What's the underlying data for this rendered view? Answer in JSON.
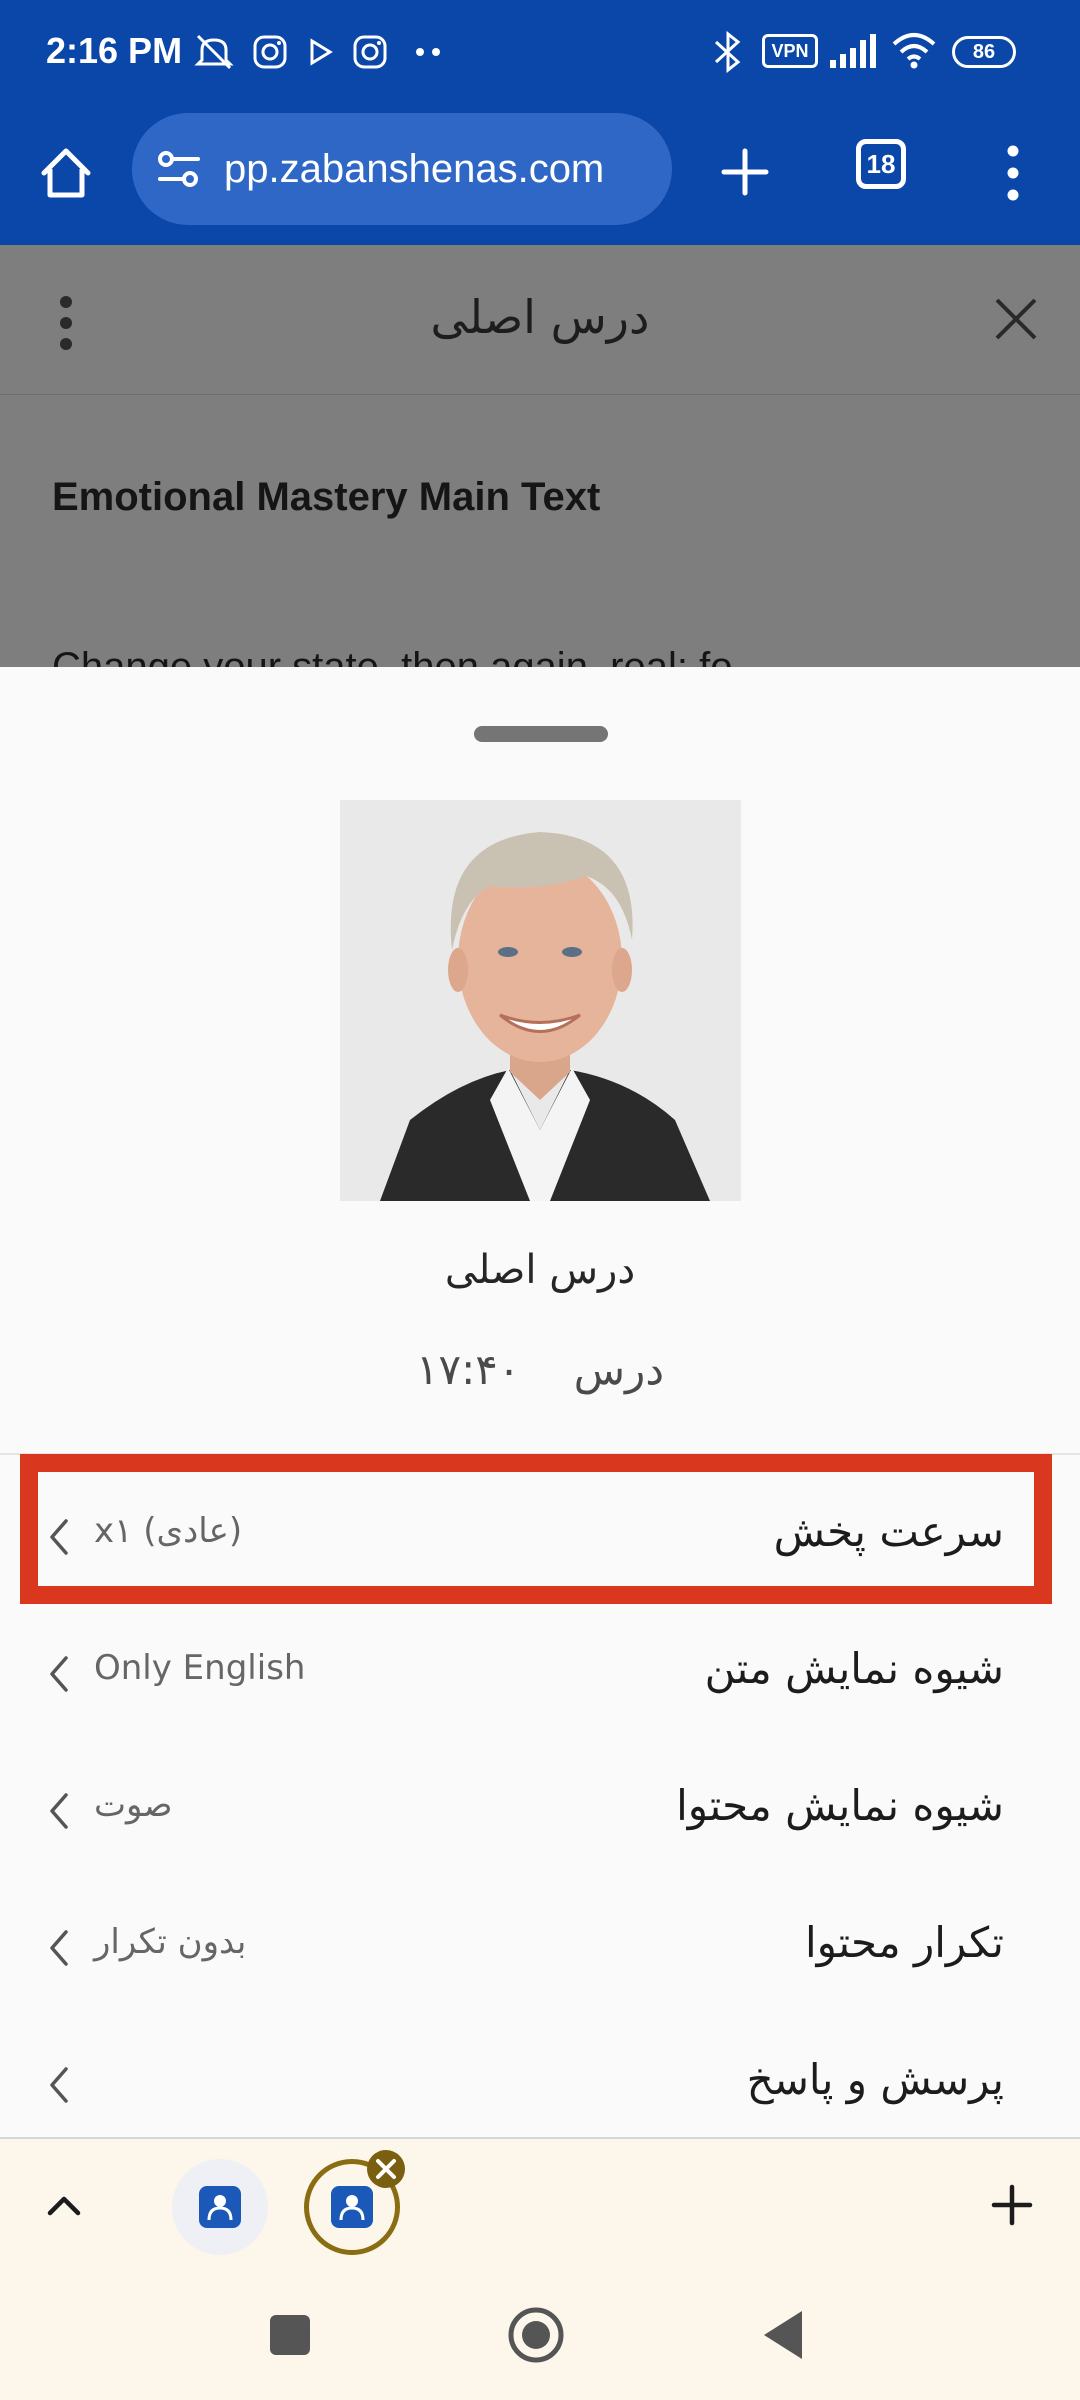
{
  "status_bar": {
    "time": "2:16 PM",
    "vpn_label": "VPN",
    "battery": "86",
    "icons": [
      "mute-icon",
      "instagram-icon",
      "play-icon",
      "instagram-icon",
      "more-dots-icon",
      "bluetooth-icon",
      "vpn-icon",
      "signal-icon",
      "wifi-icon",
      "battery-icon"
    ]
  },
  "browser": {
    "url": "app.zabanshenas.com",
    "url_visible": "pp.zabanshenas.com",
    "tab_count": "18",
    "icons": [
      "home-icon",
      "site-settings-icon",
      "new-tab-icon",
      "tab-switcher-icon",
      "menu-icon"
    ]
  },
  "page_header": {
    "title": "درس اصلی"
  },
  "page_content": {
    "heading": "Emotional Mastery Main Text",
    "partial_line": "Change your state, then again, real: fo"
  },
  "sheet": {
    "title": "درس اصلی",
    "subtitle_label": "درس",
    "duration": "۱۷:۴۰",
    "menu": [
      {
        "label": "سرعت پخش",
        "value": "x۱ (عادی)",
        "highlighted": true
      },
      {
        "label": "شیوه نمایش متن",
        "value": "Only English"
      },
      {
        "label": "شیوه نمایش محتوا",
        "value": "صوت"
      },
      {
        "label": "تکرار محتوا",
        "value": "بدون تکرار"
      },
      {
        "label": "پرسش و پاسخ",
        "value": ""
      }
    ]
  },
  "bottom_bar": {
    "icons": [
      "chevron-up-icon",
      "app-tab-icon",
      "app-tab-active-icon",
      "close-badge-icon",
      "add-tab-icon"
    ]
  },
  "nav_bar": {
    "icons": [
      "recents-square-icon",
      "home-circle-icon",
      "back-triangle-icon"
    ]
  },
  "colors": {
    "browser_blue": "#0a47a8",
    "url_pill": "#2f67c7",
    "highlight_red": "#d9381e",
    "scrim": "#7e7e7e",
    "bottom_bar_bg": "#fdf6ea",
    "active_tab_ring": "#8a6d12"
  }
}
